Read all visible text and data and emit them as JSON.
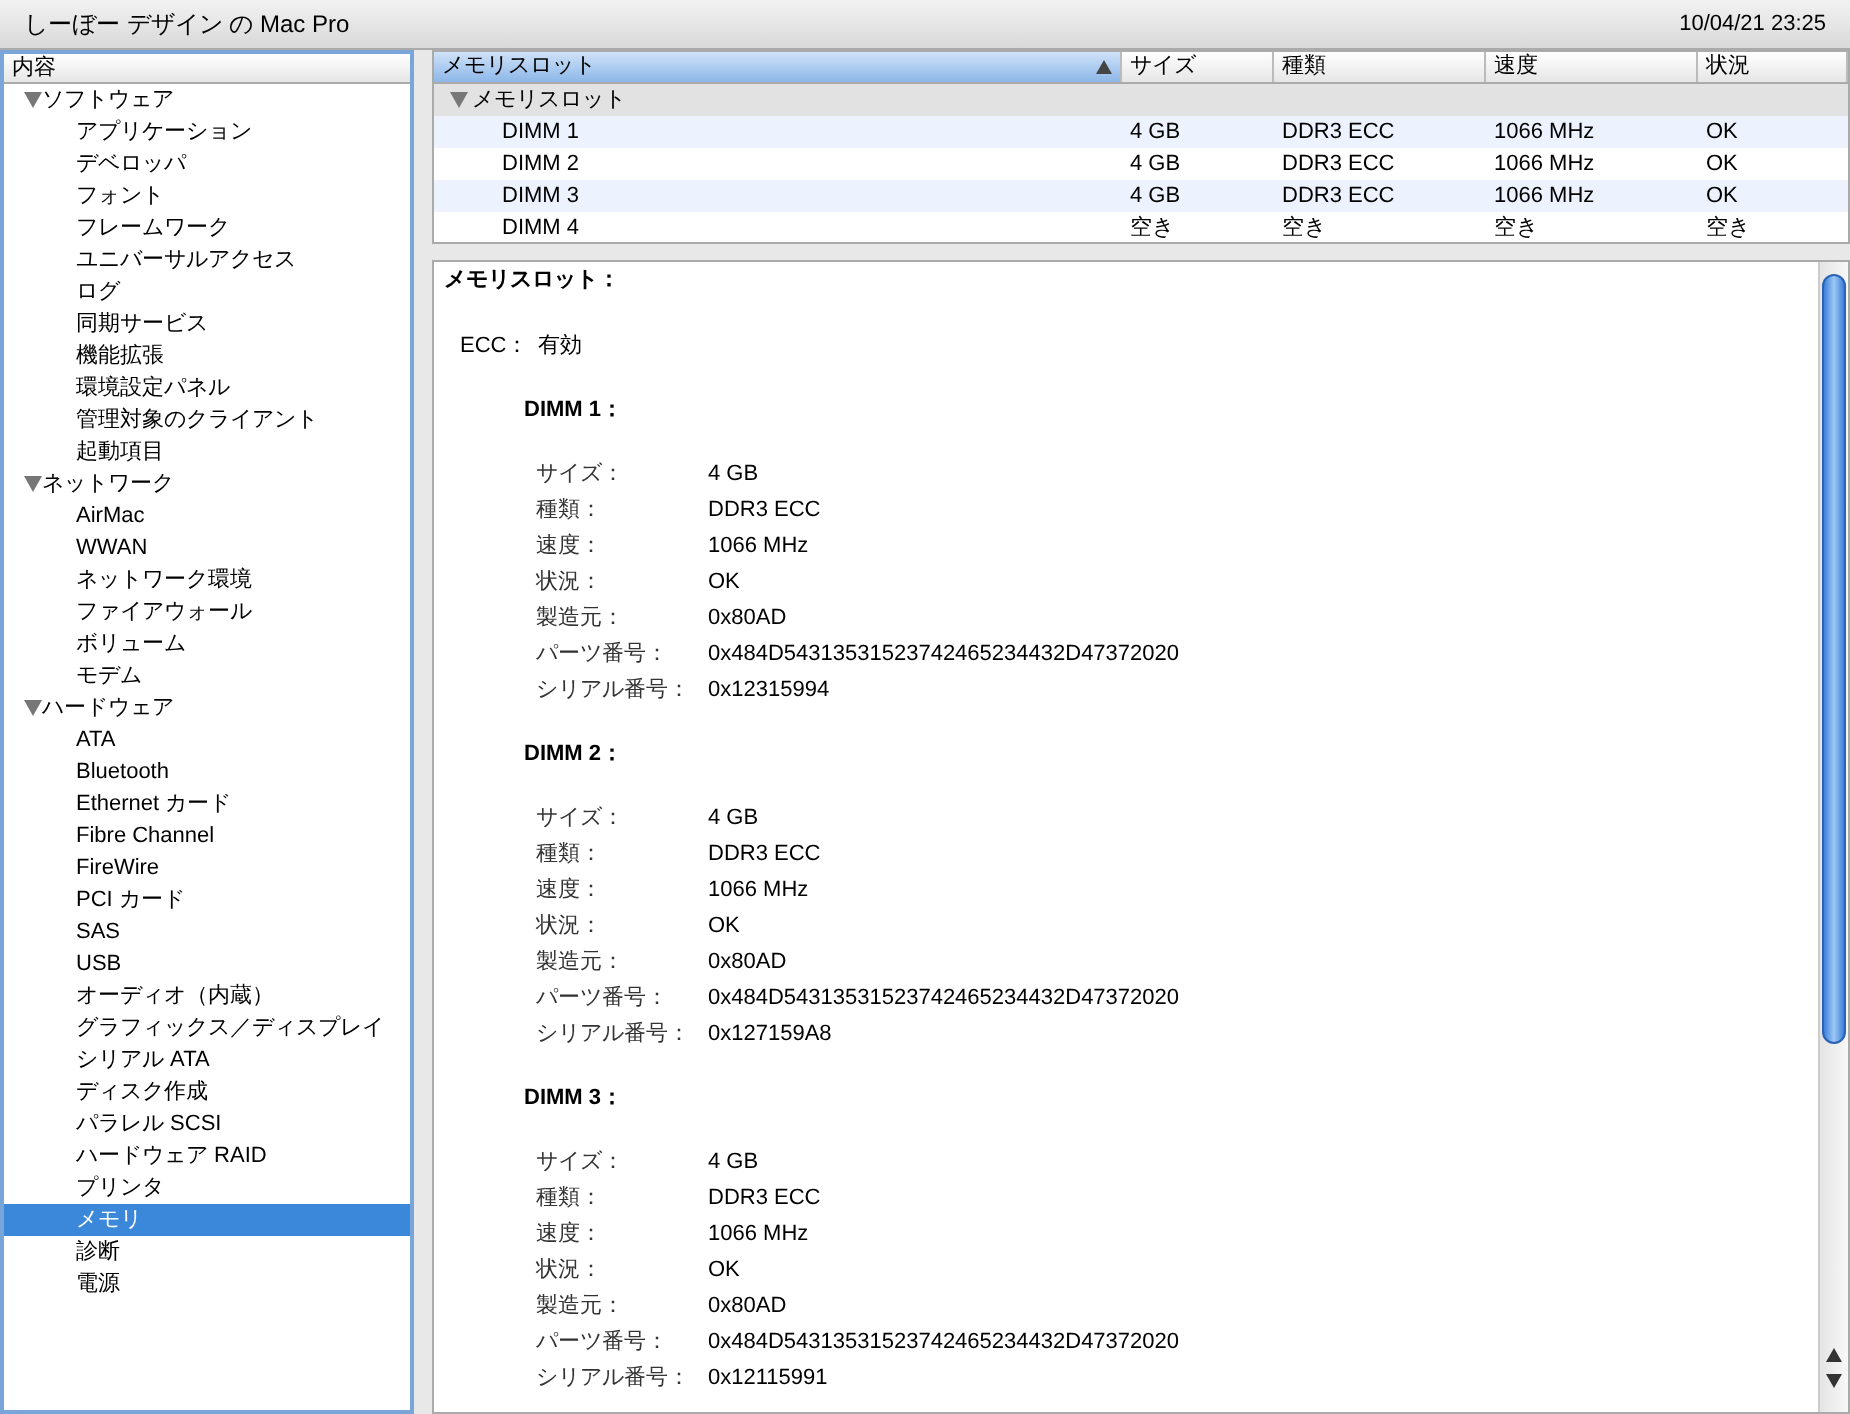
{
  "window": {
    "title": "しーぼー デザイン の Mac Pro",
    "datetime": "10/04/21 23:25"
  },
  "sidebar": {
    "header": "内容",
    "items": [
      {
        "label": "ソフトウェア",
        "expanded": true,
        "selected": false,
        "children": [
          {
            "label": "アプリケーション",
            "selected": false
          },
          {
            "label": "デベロッパ",
            "selected": false
          },
          {
            "label": "フォント",
            "selected": false
          },
          {
            "label": "フレームワーク",
            "selected": false
          },
          {
            "label": "ユニバーサルアクセス",
            "selected": false
          },
          {
            "label": "ログ",
            "selected": false
          },
          {
            "label": "同期サービス",
            "selected": false
          },
          {
            "label": "機能拡張",
            "selected": false
          },
          {
            "label": "環境設定パネル",
            "selected": false
          },
          {
            "label": "管理対象のクライアント",
            "selected": false
          },
          {
            "label": "起動項目",
            "selected": false
          }
        ]
      },
      {
        "label": "ネットワーク",
        "expanded": true,
        "selected": false,
        "children": [
          {
            "label": "AirMac",
            "selected": false
          },
          {
            "label": "WWAN",
            "selected": false
          },
          {
            "label": "ネットワーク環境",
            "selected": false
          },
          {
            "label": "ファイアウォール",
            "selected": false
          },
          {
            "label": "ボリューム",
            "selected": false
          },
          {
            "label": "モデム",
            "selected": false
          }
        ]
      },
      {
        "label": "ハードウェア",
        "expanded": true,
        "selected": false,
        "children": [
          {
            "label": "ATA",
            "selected": false
          },
          {
            "label": "Bluetooth",
            "selected": false
          },
          {
            "label": "Ethernet カード",
            "selected": false
          },
          {
            "label": "Fibre Channel",
            "selected": false
          },
          {
            "label": "FireWire",
            "selected": false
          },
          {
            "label": "PCI カード",
            "selected": false
          },
          {
            "label": "SAS",
            "selected": false
          },
          {
            "label": "USB",
            "selected": false
          },
          {
            "label": "オーディオ（内蔵）",
            "selected": false
          },
          {
            "label": "グラフィックス／ディスプレイ",
            "selected": false
          },
          {
            "label": "シリアル ATA",
            "selected": false
          },
          {
            "label": "ディスク作成",
            "selected": false
          },
          {
            "label": "パラレル SCSI",
            "selected": false
          },
          {
            "label": "ハードウェア RAID",
            "selected": false
          },
          {
            "label": "プリンタ",
            "selected": false
          },
          {
            "label": "メモリ",
            "selected": true
          },
          {
            "label": "診断",
            "selected": false
          },
          {
            "label": "電源",
            "selected": false
          }
        ]
      }
    ]
  },
  "table": {
    "columns": [
      {
        "label": "メモリスロット",
        "sorted": true
      },
      {
        "label": "サイズ",
        "sorted": false
      },
      {
        "label": "種類",
        "sorted": false
      },
      {
        "label": "速度",
        "sorted": false
      },
      {
        "label": "状況",
        "sorted": false
      }
    ],
    "group": {
      "label": "メモリスロット",
      "expanded": true
    },
    "rows": [
      [
        "DIMM 1",
        "4 GB",
        "DDR3 ECC",
        "1066 MHz",
        "OK"
      ],
      [
        "DIMM 2",
        "4 GB",
        "DDR3 ECC",
        "1066 MHz",
        "OK"
      ],
      [
        "DIMM 3",
        "4 GB",
        "DDR3 ECC",
        "1066 MHz",
        "OK"
      ],
      [
        "DIMM 4",
        "空き",
        "空き",
        "空き",
        "空き"
      ]
    ]
  },
  "detail": {
    "title": "メモリスロット：",
    "ecc": {
      "label": "ECC：",
      "value": "有効"
    },
    "dimms": [
      {
        "title": "DIMM 1：",
        "fields": [
          {
            "label": "サイズ：",
            "value": "4 GB"
          },
          {
            "label": "種類：",
            "value": "DDR3 ECC"
          },
          {
            "label": "速度：",
            "value": "1066 MHz"
          },
          {
            "label": "状況：",
            "value": "OK"
          },
          {
            "label": "製造元：",
            "value": "0x80AD"
          },
          {
            "label": "パーツ番号：",
            "value": "0x484D54313531523742465234432D47372020"
          },
          {
            "label": "シリアル番号：",
            "value": "0x12315994"
          }
        ]
      },
      {
        "title": "DIMM 2：",
        "fields": [
          {
            "label": "サイズ：",
            "value": "4 GB"
          },
          {
            "label": "種類：",
            "value": "DDR3 ECC"
          },
          {
            "label": "速度：",
            "value": "1066 MHz"
          },
          {
            "label": "状況：",
            "value": "OK"
          },
          {
            "label": "製造元：",
            "value": "0x80AD"
          },
          {
            "label": "パーツ番号：",
            "value": "0x484D54313531523742465234432D47372020"
          },
          {
            "label": "シリアル番号：",
            "value": "0x127159A8"
          }
        ]
      },
      {
        "title": "DIMM 3：",
        "fields": [
          {
            "label": "サイズ：",
            "value": "4 GB"
          },
          {
            "label": "種類：",
            "value": "DDR3 ECC"
          },
          {
            "label": "速度：",
            "value": "1066 MHz"
          },
          {
            "label": "状況：",
            "value": "OK"
          },
          {
            "label": "製造元：",
            "value": "0x80AD"
          },
          {
            "label": "パーツ番号：",
            "value": "0x484D54313531523742465234432D47372020"
          },
          {
            "label": "シリアル番号：",
            "value": "0x12115991"
          }
        ]
      }
    ]
  }
}
